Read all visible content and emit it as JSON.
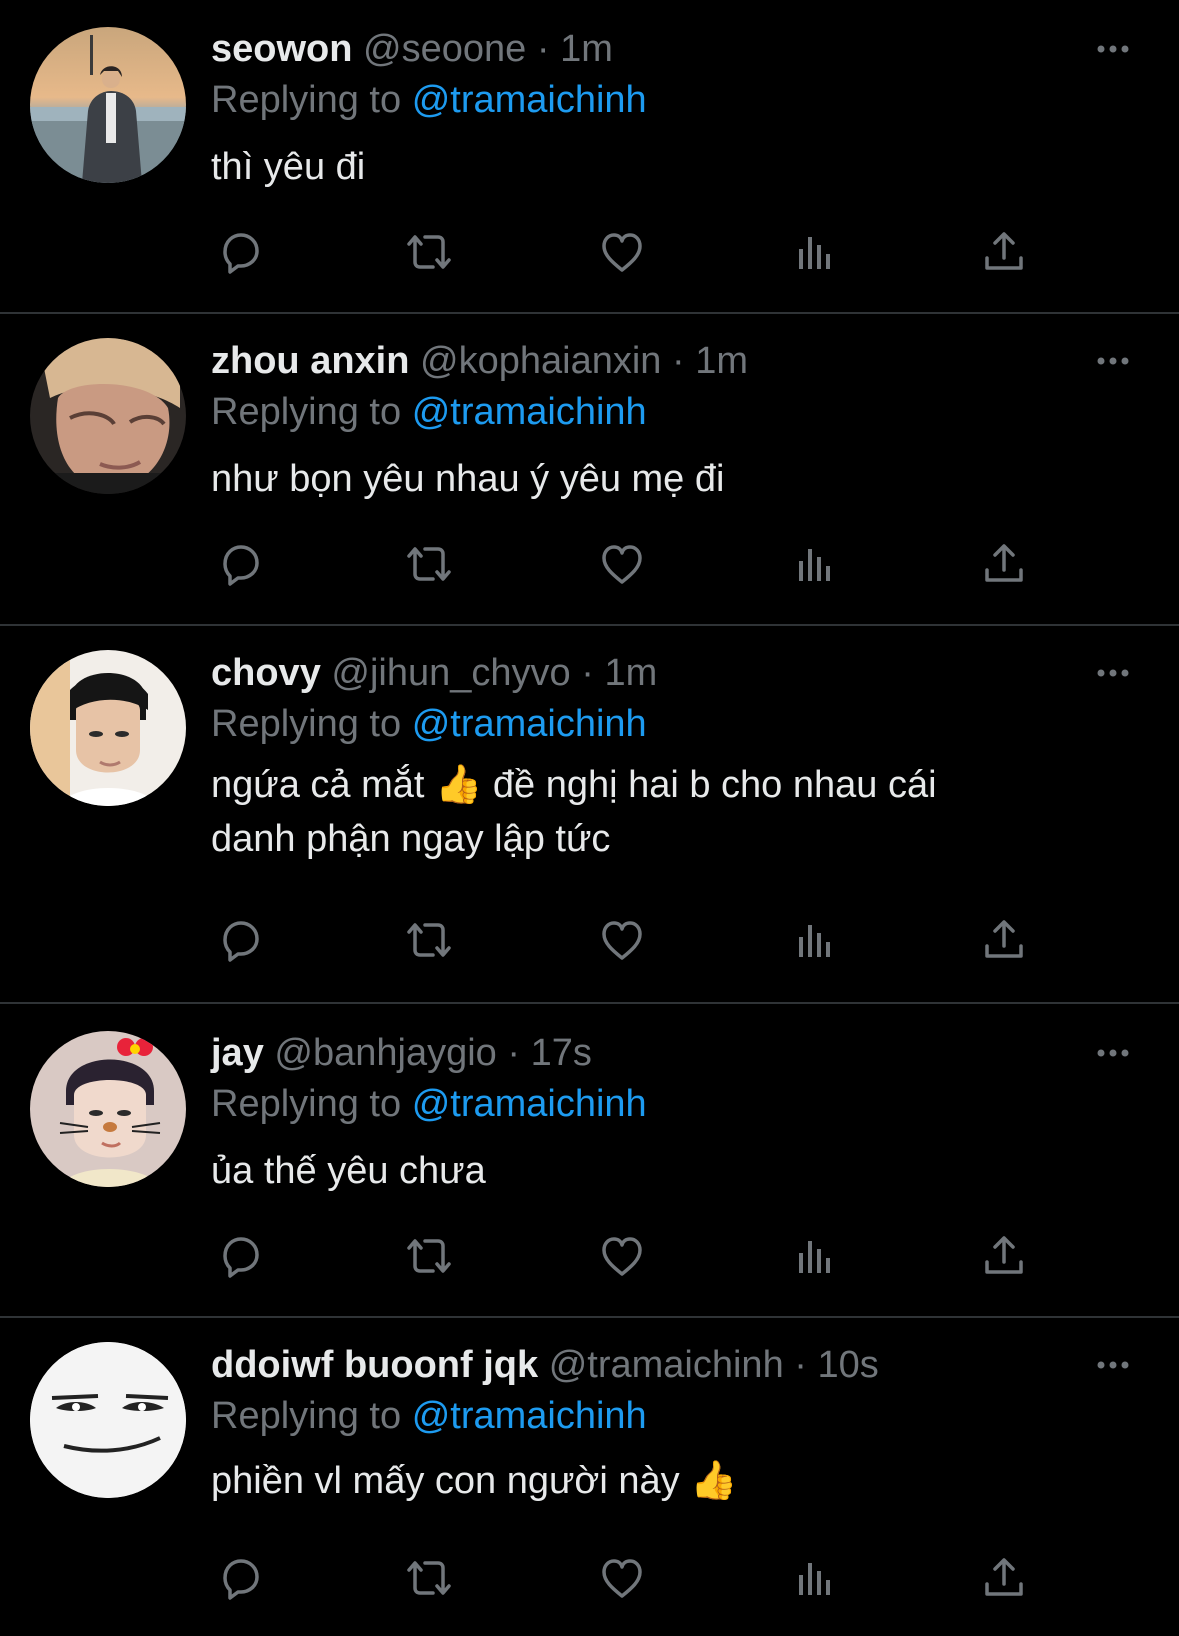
{
  "replies": [
    {
      "name": "seowon",
      "handle": "@seoone",
      "separator": "·",
      "time": "1m",
      "replying_prefix": "Replying to",
      "replying_to": "@tramaichinh",
      "text": "thì yêu đi"
    },
    {
      "name": "zhou anxin",
      "handle": "@kophaianxin",
      "separator": "·",
      "time": "1m",
      "replying_prefix": "Replying to",
      "replying_to": "@tramaichinh",
      "text": "như bọn yêu nhau ý yêu mẹ đi"
    },
    {
      "name": "chovy",
      "handle": "@jihun_chyvo",
      "separator": "·",
      "time": "1m",
      "replying_prefix": "Replying to",
      "replying_to": "@tramaichinh",
      "text_line1": "ngứa cả mắt 👍  đề nghị hai b cho nhau cái",
      "text_line2": "danh phận ngay lập tức"
    },
    {
      "name": "jay",
      "handle": "@banhjaygio",
      "separator": "·",
      "time": "17s",
      "replying_prefix": "Replying to",
      "replying_to": "@tramaichinh",
      "text": "ủa thế yêu chưa"
    },
    {
      "name": "ddoiwf buoonf jqk",
      "handle": "@tramaichinh",
      "separator": "·",
      "time": "10s",
      "replying_prefix": "Replying to",
      "replying_to": "@tramaichinh",
      "text": "phiền vl mấy con người này 👍"
    }
  ],
  "icons": {
    "more": "more-horizontal-icon",
    "reply": "reply-bubble-icon",
    "retweet": "retweet-icon",
    "like": "heart-icon",
    "views": "views-bar-chart-icon",
    "share": "share-upload-icon"
  },
  "colors": {
    "background": "#000000",
    "name": "#e7e9ea",
    "secondary": "#71767b",
    "mention": "#1d9bf0",
    "divider": "#2f3336"
  }
}
